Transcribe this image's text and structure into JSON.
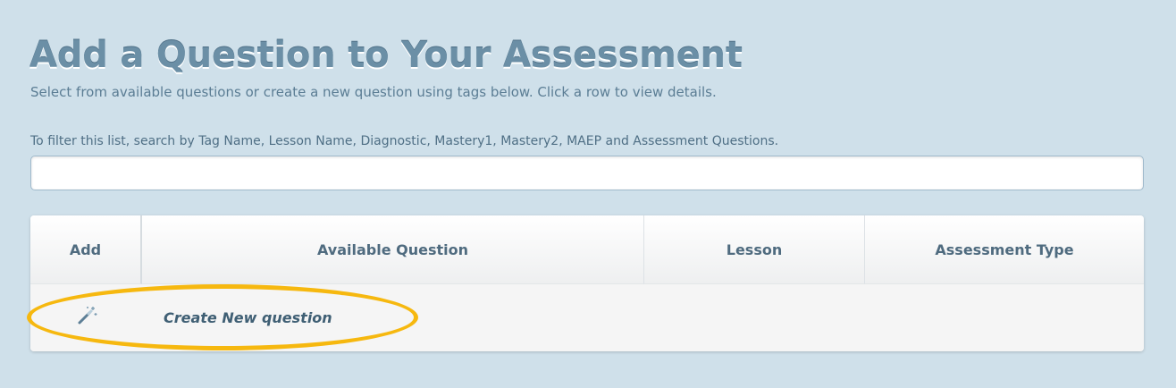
{
  "header": {
    "title": "Add a Question to Your Assessment",
    "subtitle": "Select from available questions or create a new question using tags below. Click a row to view details."
  },
  "filter": {
    "label": "To filter this list, search by Tag Name, Lesson Name, Diagnostic, Mastery1, Mastery2, MAEP and Assessment Questions.",
    "value": "",
    "placeholder": ""
  },
  "table": {
    "columns": [
      "Add",
      "Available Question",
      "Lesson",
      "Assessment Type"
    ],
    "rows": [
      {
        "icon": "magic-wand-icon",
        "question": "Create New question",
        "lesson": "",
        "assessment_type": ""
      }
    ]
  },
  "colors": {
    "background": "#cfe0ea",
    "title": "#6b8fa6",
    "highlight": "#f6b80f",
    "table_header_text": "#4f6b7f",
    "link_text": "#3f5f74"
  }
}
